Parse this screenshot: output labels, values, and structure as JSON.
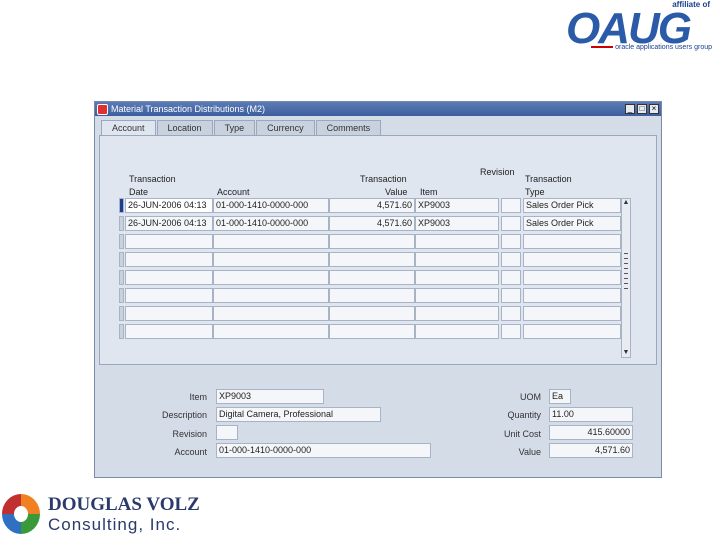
{
  "logos": {
    "oaug_affiliate": "affiliate of",
    "oaug_word": "OAUG",
    "oaug_tagline": "oracle applications users group",
    "company_line1": "DOUGLAS VOLZ",
    "company_line2": "Consulting, Inc."
  },
  "window": {
    "title": "Material Transaction Distributions (M2)",
    "controls": [
      "_",
      "□",
      "×"
    ]
  },
  "tabs": [
    {
      "label": "Account",
      "active": true
    },
    {
      "label": "Location",
      "active": false
    },
    {
      "label": "Type",
      "active": false
    },
    {
      "label": "Currency",
      "active": false
    },
    {
      "label": "Comments",
      "active": false
    }
  ],
  "columns": {
    "date_line1": "Transaction",
    "date_line2": "Date",
    "account": "Account",
    "value_line1": "Transaction",
    "value_line2": "Value",
    "item": "Item",
    "revision": "Revision",
    "type_line1": "Transaction",
    "type_line2": "Type"
  },
  "rows": [
    {
      "date": "26-JUN-2006 04:13",
      "account": "01-000-1410-0000-000",
      "value": "4,571.60",
      "item": "XP9003",
      "revision": "",
      "type": "Sales Order Pick"
    },
    {
      "date": "26-JUN-2006 04:13",
      "account": "01-000-1410-0000-000",
      "value": "4,571.60",
      "item": "XP9003",
      "revision": "",
      "type": "Sales Order Pick"
    },
    {
      "date": "",
      "account": "",
      "value": "",
      "item": "",
      "revision": "",
      "type": ""
    },
    {
      "date": "",
      "account": "",
      "value": "",
      "item": "",
      "revision": "",
      "type": ""
    },
    {
      "date": "",
      "account": "",
      "value": "",
      "item": "",
      "revision": "",
      "type": ""
    },
    {
      "date": "",
      "account": "",
      "value": "",
      "item": "",
      "revision": "",
      "type": ""
    },
    {
      "date": "",
      "account": "",
      "value": "",
      "item": "",
      "revision": "",
      "type": ""
    },
    {
      "date": "",
      "account": "",
      "value": "",
      "item": "",
      "revision": "",
      "type": ""
    }
  ],
  "details": {
    "item_label": "Item",
    "item_value": "XP9003",
    "description_label": "Description",
    "description_value": "Digital Camera, Professional",
    "revision_label": "Revision",
    "revision_value": "",
    "account_label": "Account",
    "account_value": "01-000-1410-0000-000",
    "uom_label": "UOM",
    "uom_value": "Ea",
    "quantity_label": "Quantity",
    "quantity_value": "11.00",
    "unit_cost_label": "Unit Cost",
    "unit_cost_value": "415.60000",
    "value_label": "Value",
    "value_value": "4,571.60"
  },
  "colors": {
    "titlebar": "#3d5e9e",
    "window_bg": "#d4dce8",
    "current_record": "#1f3d8f"
  }
}
